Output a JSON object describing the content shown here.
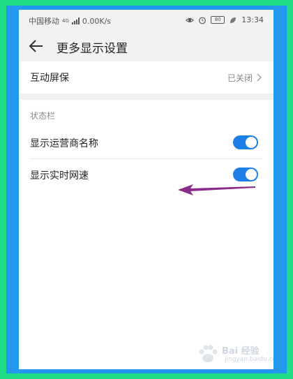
{
  "status_bar": {
    "carrier": "中国移动",
    "network_badge": "4G",
    "net_speed": "0.00K/s",
    "battery": "80",
    "time": "13:34"
  },
  "app_bar": {
    "title": "更多显示设置"
  },
  "settings": {
    "screensaver": {
      "label": "互动屏保",
      "value": "已关闭"
    },
    "status_bar_section": "状态栏",
    "show_carrier": {
      "label": "显示运营商名称",
      "on": true
    },
    "show_speed": {
      "label": "显示实时网速",
      "on": true
    }
  },
  "watermark": {
    "brand": "Bai 经验",
    "url": "jingyan.baidu.com"
  },
  "colors": {
    "outer_frame": "#22dd88",
    "inner_frame": "#2299ee",
    "toggle_on": "#1b7fe6",
    "annotation_arrow": "#8a2a8a"
  },
  "icons": [
    "signal-icon",
    "eye-icon",
    "alarm-icon",
    "battery-icon",
    "leaf-icon",
    "back-arrow-icon",
    "chevron-right-icon",
    "paw-icon"
  ]
}
